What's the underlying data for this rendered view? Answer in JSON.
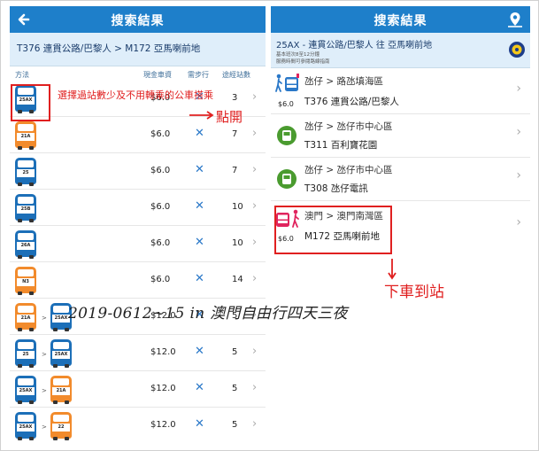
{
  "left": {
    "header_title": "搜索結果",
    "route_title": "T376 連貫公路/巴黎人 > M172 亞馬喇前地",
    "columns": {
      "method": "方法",
      "fare": "現金車資",
      "walk": "需步行",
      "stops": "途經站數"
    },
    "rows": [
      {
        "buses": [
          {
            "label": "25AX",
            "color": "blue"
          }
        ],
        "fare": "$6.0",
        "walk": "✕",
        "stops": "3"
      },
      {
        "buses": [
          {
            "label": "21A",
            "color": "orange"
          }
        ],
        "fare": "$6.0",
        "walk": "✕",
        "stops": "7"
      },
      {
        "buses": [
          {
            "label": "25",
            "color": "blue"
          }
        ],
        "fare": "$6.0",
        "walk": "✕",
        "stops": "7"
      },
      {
        "buses": [
          {
            "label": "25B",
            "color": "blue"
          }
        ],
        "fare": "$6.0",
        "walk": "✕",
        "stops": "10"
      },
      {
        "buses": [
          {
            "label": "26A",
            "color": "blue"
          }
        ],
        "fare": "$6.0",
        "walk": "✕",
        "stops": "10"
      },
      {
        "buses": [
          {
            "label": "N3",
            "color": "orange"
          }
        ],
        "fare": "$6.0",
        "walk": "✕",
        "stops": "14"
      },
      {
        "buses": [
          {
            "label": "21A",
            "color": "orange"
          },
          {
            "label": "25AX",
            "color": "blue"
          }
        ],
        "fare": "$12.0",
        "walk": "✕",
        "stops": "5"
      },
      {
        "buses": [
          {
            "label": "25",
            "color": "blue"
          },
          {
            "label": "25AX",
            "color": "blue"
          }
        ],
        "fare": "$12.0",
        "walk": "✕",
        "stops": "5"
      },
      {
        "buses": [
          {
            "label": "25AX",
            "color": "blue"
          },
          {
            "label": "21A",
            "color": "orange"
          }
        ],
        "fare": "$12.0",
        "walk": "✕",
        "stops": "5"
      },
      {
        "buses": [
          {
            "label": "25AX",
            "color": "blue"
          },
          {
            "label": "22",
            "color": "orange"
          }
        ],
        "fare": "$12.0",
        "walk": "✕",
        "stops": "5"
      }
    ],
    "transfer_arrow": ">",
    "chevron": "›"
  },
  "right": {
    "header_title": "搜索結果",
    "route_title": "25AX - 連貫公路/巴黎人 往 亞馬喇前地",
    "route_note_1": "基本班次8至12分鐘",
    "route_note_2": "服務時間可參閱路線指南",
    "price": "$6.0",
    "steps": [
      {
        "line1": "氹仔 > 路氹填海區",
        "line2": "T376 連貫公路/巴黎人"
      },
      {
        "line1": "氹仔 > 氹仔市中心區",
        "line2": "T311 百利寶花園"
      },
      {
        "line1": "氹仔 > 氹仔市中心區",
        "line2": "T308 氹仔電訊"
      },
      {
        "line1": "澳門 > 澳門南灣區",
        "line2": "M172 亞馬喇前地"
      }
    ]
  },
  "annotations": {
    "select_note": "選擇過站數少及不用轉乘的公車搭乘",
    "tap_open": "點開",
    "get_off": "下車到站",
    "watermark": "2019-0612~15 in 澳門自由行四天三夜"
  },
  "colors": {
    "header": "#1e7fca",
    "subheader": "#dfeefa",
    "bus_blue": "#1c6fb8",
    "bus_orange": "#f28b2c",
    "stop_green": "#4a9b2f",
    "annotation": "#e02020"
  }
}
